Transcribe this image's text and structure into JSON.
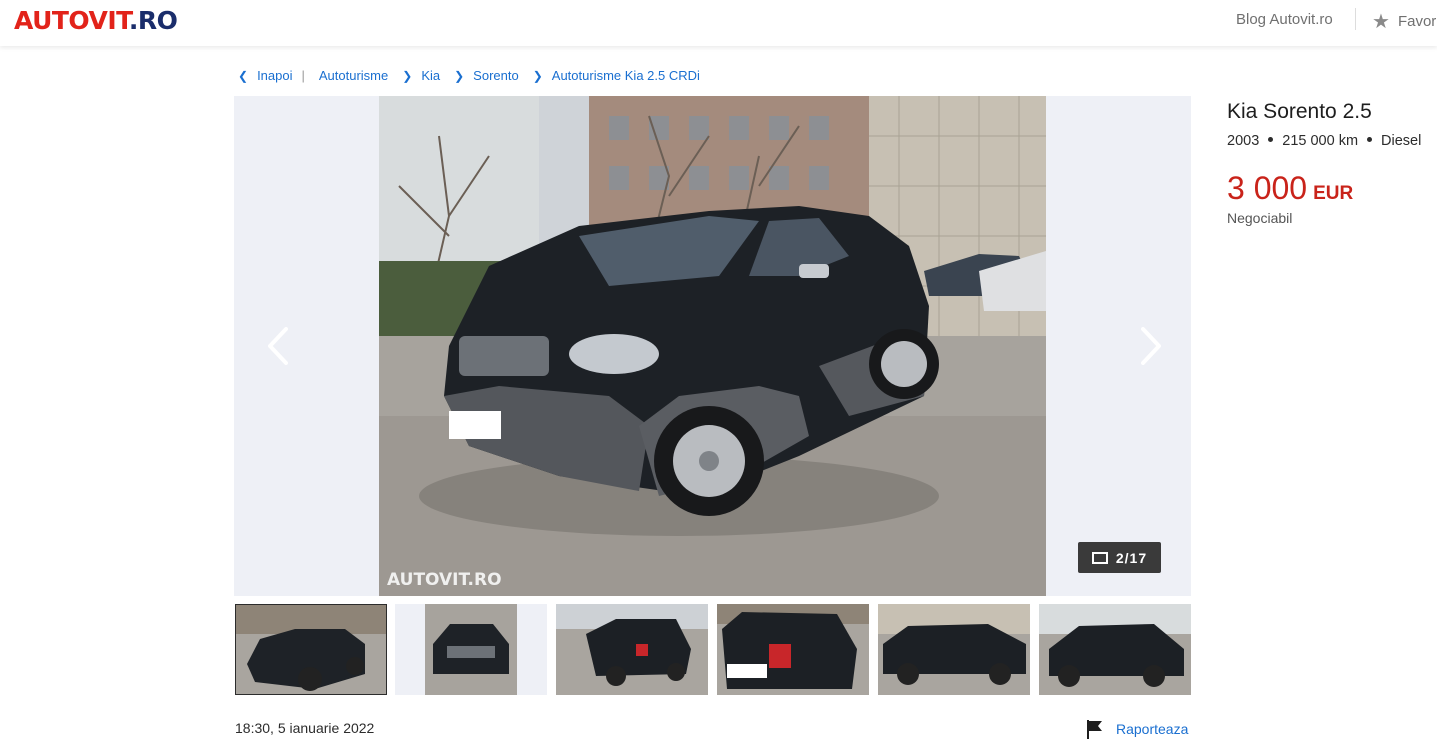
{
  "header": {
    "logo_main": "AUTOVIT",
    "logo_dot": ".RO",
    "blog_link": "Blog Autovit.ro",
    "favorites_label": "Favor"
  },
  "breadcrumb": {
    "back": "Inapoi",
    "items": [
      "Autoturisme",
      "Kia",
      "Sorento",
      "Autoturisme Kia 2.5 CRDi"
    ]
  },
  "gallery": {
    "counter": "2/17",
    "watermark": "AUTOVIT.RO",
    "thumb_count": 6
  },
  "listing": {
    "title": "Kia Sorento 2.5",
    "year": "2003",
    "mileage": "215 000 km",
    "fuel": "Diesel",
    "price": "3 000",
    "currency": "EUR",
    "negotiable": "Negociabil",
    "date": "18:30, 5 ianuarie 2022",
    "report_label": "Raporteaza"
  },
  "colors": {
    "brand_red": "#e2231a",
    "brand_navy": "#1a2d6b",
    "link_blue": "#1a6fd0",
    "price_red": "#c9231a"
  },
  "icons": [
    "chevron-left-icon",
    "chevron-right-icon",
    "star-icon",
    "gallery-icon",
    "flag-icon"
  ]
}
